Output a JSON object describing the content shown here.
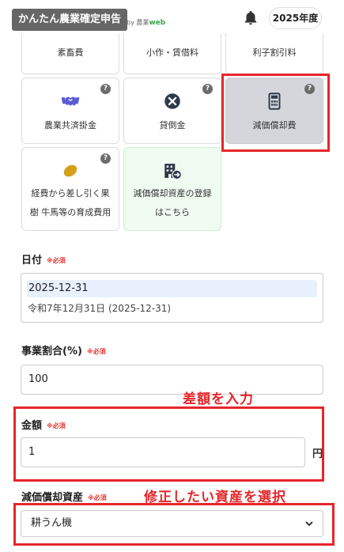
{
  "header": {
    "app_title": "かんたん農業確定申告",
    "byline_prefix": "by 農業",
    "byline_brand": "web",
    "year_label": "2025年度"
  },
  "categories": [
    {
      "label": "素畜費",
      "icon": ""
    },
    {
      "label": "小作・賃借料",
      "icon": ""
    },
    {
      "label": "利子割引料",
      "icon": ""
    },
    {
      "label": "農業共済掛金",
      "icon": "handshake-icon",
      "icon_color": "#5b5bd6"
    },
    {
      "label": "貸倒金",
      "icon": "close-circle-icon",
      "icon_color": "#2f3a4a"
    },
    {
      "label": "減価償却費",
      "icon": "calculator-icon",
      "icon_color": "#2f3a4a",
      "selected": true
    },
    {
      "label_line1": "経費から差し引く果",
      "label_line2": "樹 牛馬等の育成費用",
      "icon": "lemon-icon",
      "icon_color": "#d4a017"
    },
    {
      "label_line1": "減価償却資産の登録",
      "label_line2": "はこちら",
      "icon": "building-arrow-icon",
      "icon_color": "#2f3a4a"
    }
  ],
  "help_mark": "?",
  "form": {
    "date_label": "日付",
    "required_mark": "※必須",
    "date_value": "2025-12-31",
    "date_wareki": "令和7年12月31日 (2025-12-31)",
    "ratio_label": "事業割合(%)",
    "ratio_value": "100",
    "amount_label": "金額",
    "amount_value": "1",
    "amount_unit": "円",
    "asset_label": "減価償却資産",
    "asset_value": "耕うん機"
  },
  "annotations": {
    "amount_note": "差額を入力",
    "asset_note": "修正したい資産を選択"
  },
  "colors": {
    "annotation_red": "#e5262b",
    "selected_card": "#d4d6dc",
    "register_card": "#f0fbf2",
    "required_red": "#e53935"
  }
}
